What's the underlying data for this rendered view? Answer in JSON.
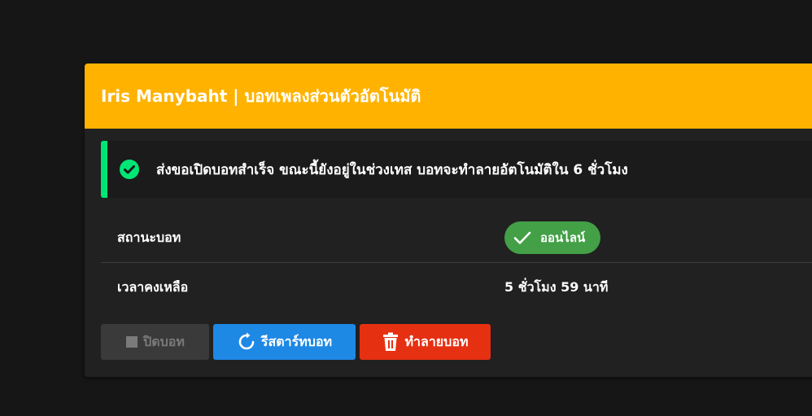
{
  "header": {
    "title": "Iris Manybaht | บอทเพลงส่วนตัวอัตโนมัติ"
  },
  "alert": {
    "icon": "check-circle-icon",
    "message": "ส่งขอเปิดบอทสำเร็จ ขณะนี้ยังอยู่ในช่วงเทส บอทจะทำลายอัตโนมัติใน 6 ชั่วโมง"
  },
  "info": {
    "status_label": "สถานะบอท",
    "status_value": "ออนไลน์",
    "time_label": "เวลาคงเหลือ",
    "time_value": "5 ชั่วโมง 59 นาที"
  },
  "actions": {
    "stop_label": "ปิดบอท",
    "restart_label": "รีสตาร์ทบอท",
    "destroy_label": "ทำลายบอท"
  },
  "colors": {
    "header": "#ffb300",
    "accent_success": "#00e676",
    "badge_online": "#43a047",
    "restart": "#1e88e5",
    "destroy": "#e53012",
    "disabled": "#3a3a3a"
  }
}
